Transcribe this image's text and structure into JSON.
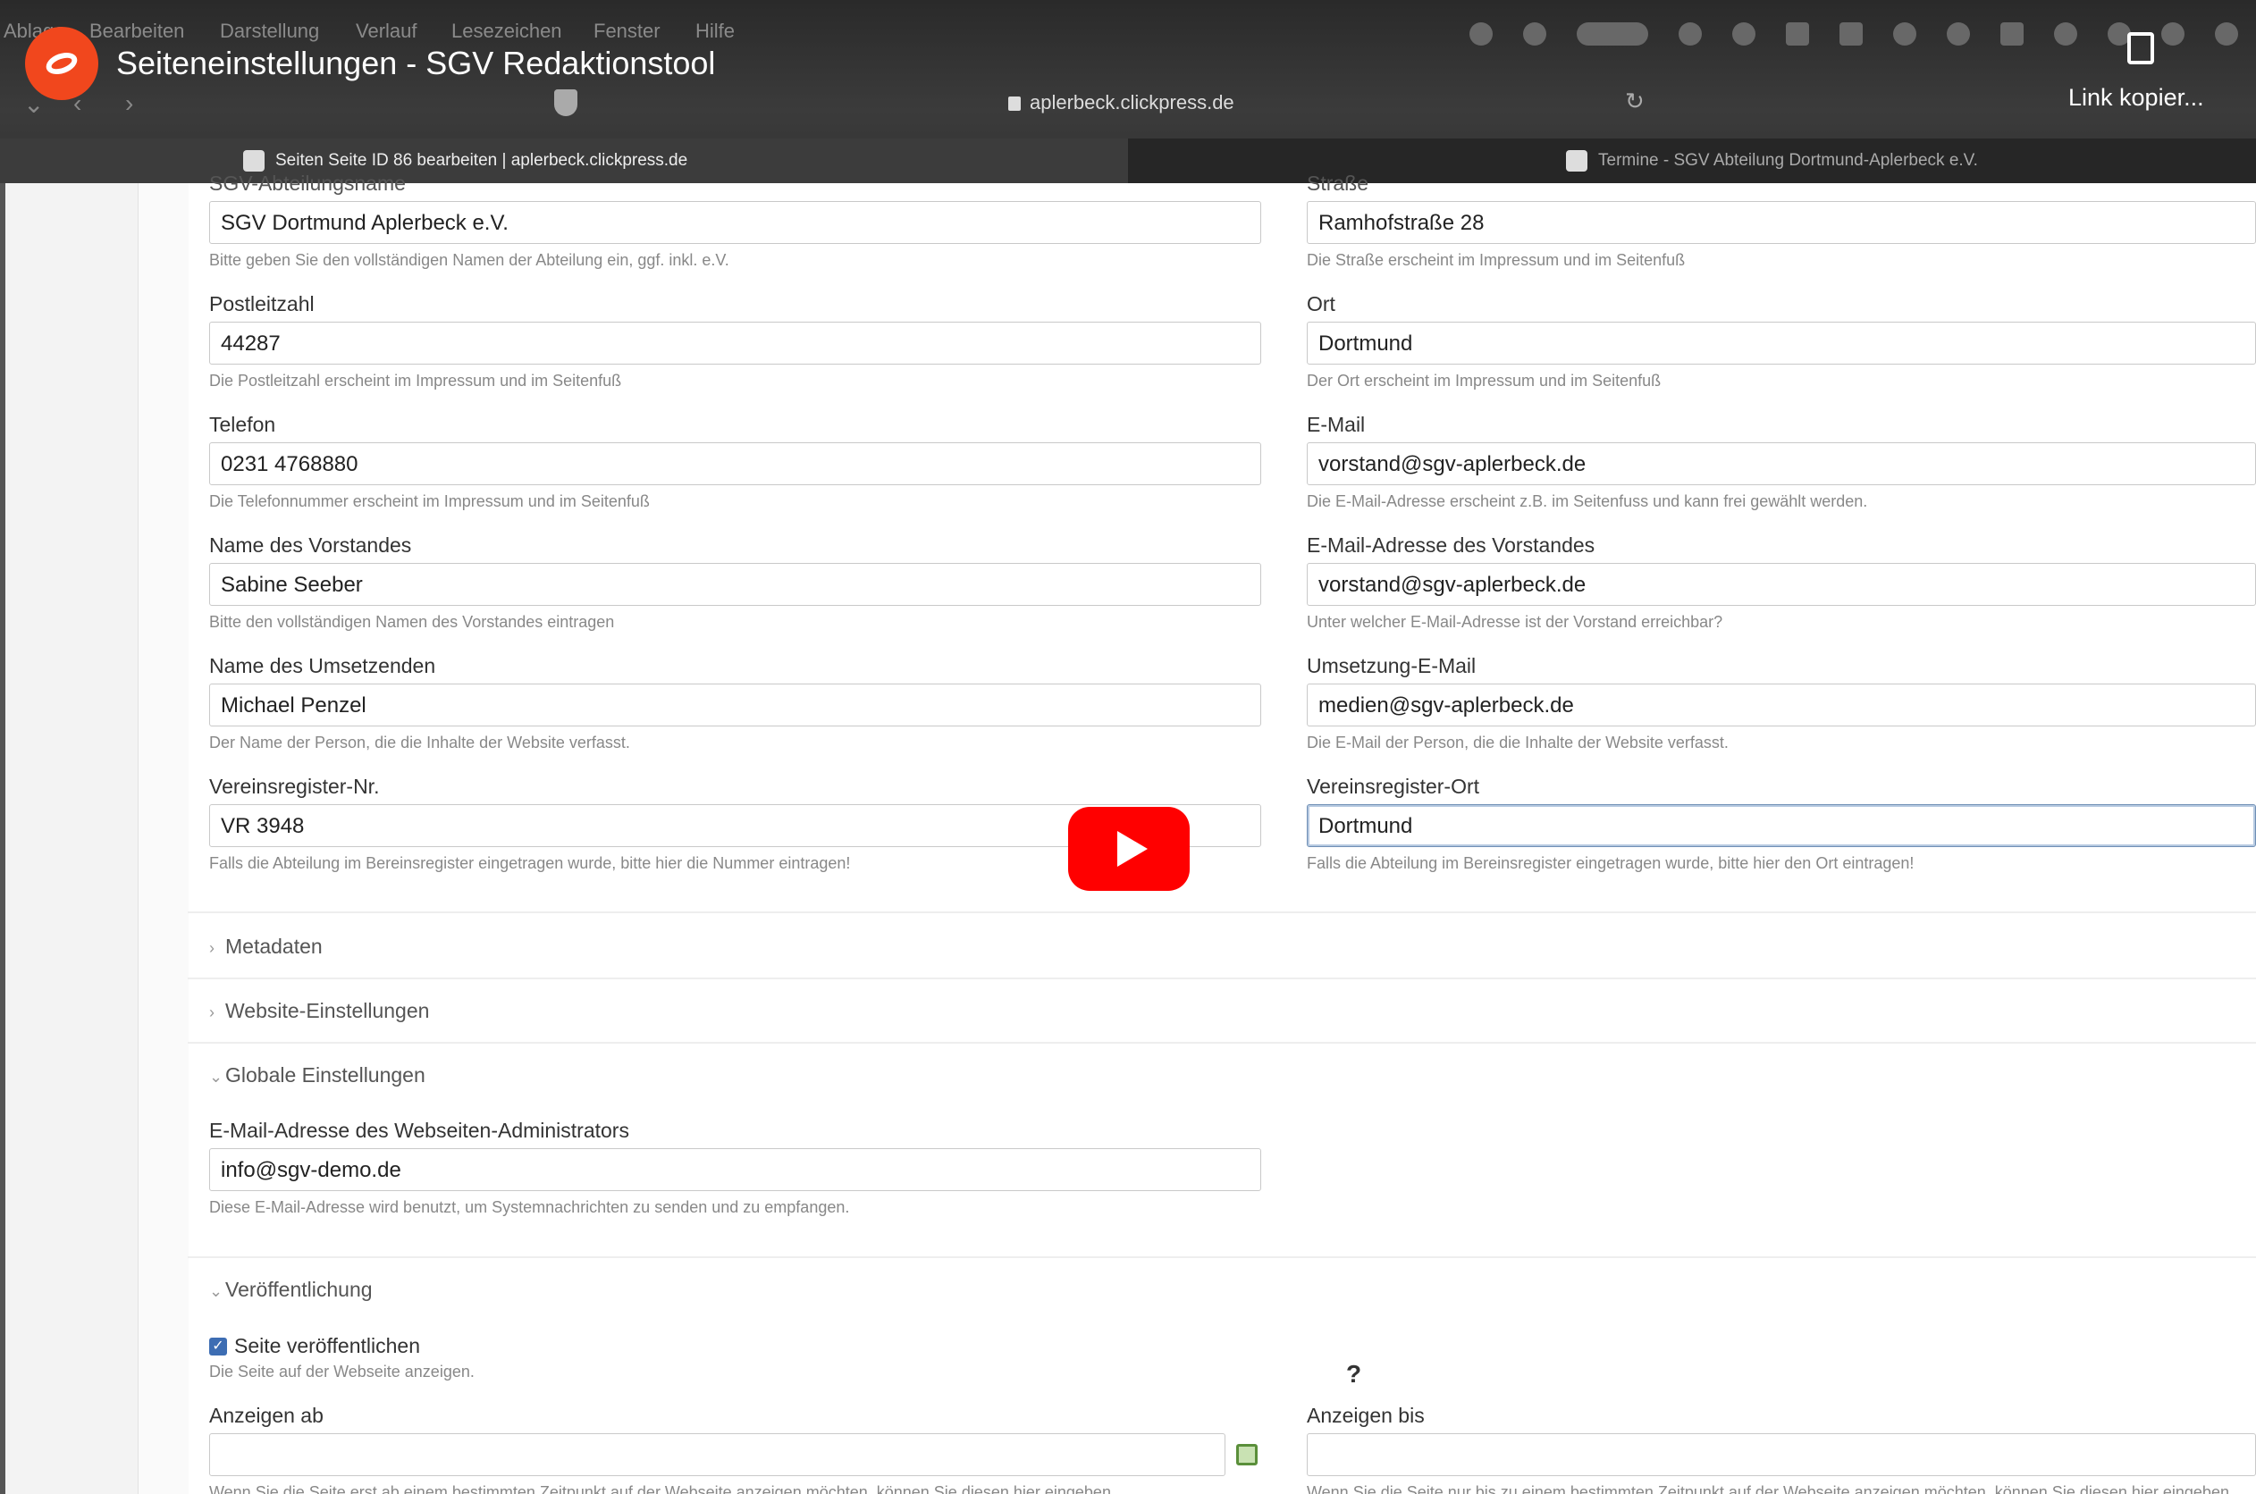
{
  "menubar": {
    "items": [
      "Ablage",
      "Bearbeiten",
      "Darstellung",
      "Verlauf",
      "Lesezeichen",
      "Fenster",
      "Hilfe"
    ]
  },
  "video": {
    "title": "Seiteneinstellungen - SGV Redaktionstool",
    "copy_link_label": "Link kopier..."
  },
  "browser": {
    "url": "aplerbeck.clickpress.de",
    "tabs": [
      {
        "label": "Seiten Seite ID 86 bearbeiten | aplerbeck.clickpress.de"
      },
      {
        "label": "Termine - SGV Abteilung Dortmund-Aplerbeck e.V."
      }
    ]
  },
  "form": {
    "top_left_label": "SGV-Abteilungsname",
    "top_right_label": "Straße",
    "abteilungsname": {
      "value": "SGV Dortmund Aplerbeck e.V.",
      "hint": "Bitte geben Sie den vollständigen Namen der Abteilung ein, ggf. inkl. e.V."
    },
    "strasse": {
      "value": "Ramhofstraße 28",
      "hint": "Die Straße erscheint im Impressum und im Seitenfuß"
    },
    "postleitzahl": {
      "label": "Postleitzahl",
      "value": "44287",
      "hint": "Die Postleitzahl erscheint im Impressum und im Seitenfuß"
    },
    "ort": {
      "label": "Ort",
      "value": "Dortmund",
      "hint": "Der Ort erscheint im Impressum und im Seitenfuß"
    },
    "telefon": {
      "label": "Telefon",
      "value": "0231 4768880",
      "hint": "Die Telefonnummer erscheint im Impressum und im Seitenfuß"
    },
    "email": {
      "label": "E-Mail",
      "value": "vorstand@sgv-aplerbeck.de",
      "hint": "Die E-Mail-Adresse erscheint z.B. im Seitenfuss und kann frei gewählt werden."
    },
    "vorstand_name": {
      "label": "Name des Vorstandes",
      "value": "Sabine Seeber",
      "hint": "Bitte den vollständigen Namen des Vorstandes eintragen"
    },
    "vorstand_email": {
      "label": "E-Mail-Adresse des Vorstandes",
      "value": "vorstand@sgv-aplerbeck.de",
      "hint": "Unter welcher E-Mail-Adresse ist der Vorstand erreichbar?"
    },
    "umsetzer_name": {
      "label": "Name des Umsetzenden",
      "value": "Michael Penzel",
      "hint": "Der Name der Person, die die Inhalte der Website verfasst."
    },
    "umsetzer_email": {
      "label": "Umsetzung-E-Mail",
      "value": "medien@sgv-aplerbeck.de",
      "hint": "Die E-Mail der Person, die die Inhalte der Website verfasst."
    },
    "vr_nr": {
      "label": "Vereinsregister-Nr.",
      "value": "VR 3948",
      "hint": "Falls die Abteilung im Bereinsregister eingetragen wurde, bitte hier die Nummer eintragen!"
    },
    "vr_ort": {
      "label": "Vereinsregister-Ort",
      "value": "Dortmund",
      "hint": "Falls die Abteilung im Bereinsregister eingetragen wurde, bitte hier den Ort eintragen!"
    }
  },
  "sections": {
    "metadaten": "Metadaten",
    "website": "Website-Einstellungen",
    "global": "Globale Einstellungen",
    "publish": "Veröffentlichung"
  },
  "global": {
    "admin_email": {
      "label": "E-Mail-Adresse des Webseiten-Administrators",
      "value": "info@sgv-demo.de",
      "hint": "Diese E-Mail-Adresse wird benutzt, um Systemnachrichten zu senden und zu empfangen."
    }
  },
  "publish": {
    "checkbox_label": "Seite veröffentlichen",
    "checkbox_hint": "Die Seite auf der Webseite anzeigen.",
    "checked": true,
    "from_label": "Anzeigen ab",
    "from_hint": "Wenn Sie die Seite erst ab einem bestimmten Zeitpunkt auf der Webseite anzeigen möchten, können Sie diesen hier eingeben.",
    "until_label": "Anzeigen bis",
    "until_hint": "Wenn Sie die Seite nur bis zu einem bestimmten Zeitpunkt auf der Webseite anzeigen möchten, können Sie diesen hier eingeben.",
    "help_mark": "?"
  }
}
